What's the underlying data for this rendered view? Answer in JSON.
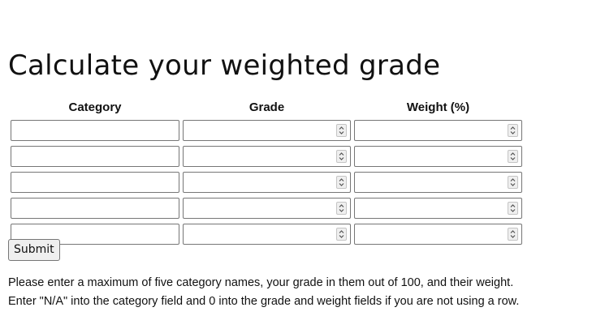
{
  "page": {
    "title": "Calculate your weighted grade"
  },
  "table": {
    "headers": [
      "Category",
      "Grade",
      "Weight (%)"
    ],
    "rows": [
      {
        "category": "",
        "grade": "",
        "weight": ""
      },
      {
        "category": "",
        "grade": "",
        "weight": ""
      },
      {
        "category": "",
        "grade": "",
        "weight": ""
      },
      {
        "category": "",
        "grade": "",
        "weight": ""
      },
      {
        "category": "",
        "grade": "",
        "weight": ""
      }
    ]
  },
  "form": {
    "submit_label": "Submit"
  },
  "instructions": {
    "line1": "Please enter a maximum of five category names, your grade in them out of 100, and their weight.",
    "line2": "Enter \"N/A\" into the category field and 0 into the grade and weight fields if you are not using a row."
  },
  "icons": {
    "spinner": "up-down-chevron-icon"
  }
}
